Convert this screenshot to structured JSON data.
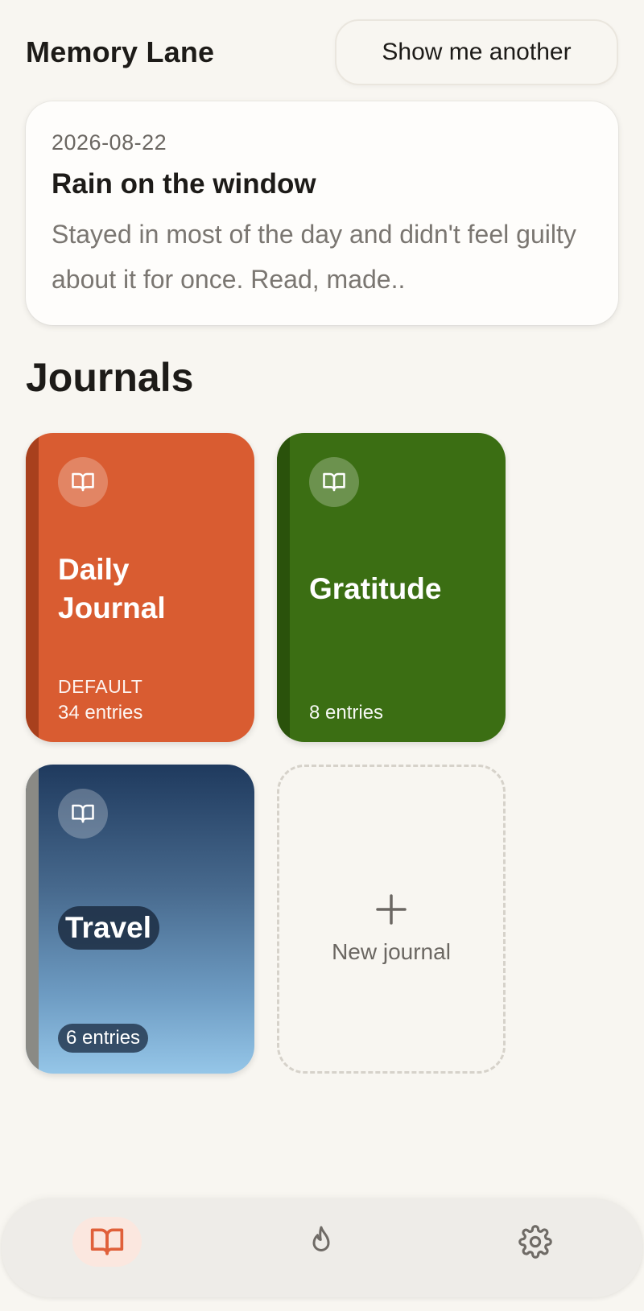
{
  "memory_lane": {
    "title": "Memory Lane",
    "show_another_label": "Show me another",
    "entry": {
      "date": "2026-08-22",
      "title": "Rain on the window",
      "excerpt": "Stayed in most of the day and didn't feel guilty about it for once. Read, made.."
    }
  },
  "journals": {
    "heading": "Journals",
    "items": [
      {
        "name_line1": "Daily",
        "name_line2": "Journal",
        "tag": "DEFAULT",
        "count": "34 entries",
        "color": "#d95c31",
        "icon": "book-icon"
      },
      {
        "name": "Gratitude",
        "count": "8 entries",
        "color": "#3b6e13",
        "icon": "book-icon"
      },
      {
        "name": "Travel",
        "count": "6 entries",
        "color": "#47698d",
        "icon": "book-icon"
      }
    ],
    "new_label": "New journal",
    "new_icon": "plus-icon"
  },
  "nav": {
    "active": "journals",
    "accent": "#e0603a",
    "items": [
      {
        "id": "journals",
        "icon": "book-icon"
      },
      {
        "id": "streak",
        "icon": "flame-icon"
      },
      {
        "id": "settings",
        "icon": "gear-icon"
      }
    ]
  }
}
